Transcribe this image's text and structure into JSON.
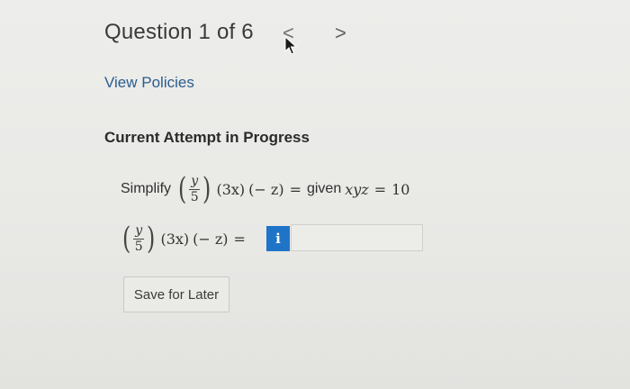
{
  "header": {
    "question_title": "Question 1 of 6",
    "prev_glyph": "<",
    "next_glyph": ">"
  },
  "links": {
    "view_policies": "View Policies"
  },
  "attempt": {
    "status": "Current Attempt in Progress"
  },
  "problem": {
    "prompt_word": "Simplify",
    "frac_num": "y",
    "frac_den": "5",
    "factor_3x": "(3x)",
    "factor_neg_z": "(− z)",
    "equals": "=",
    "given_word": "given",
    "condition_var": "xyz",
    "condition_value": "10"
  },
  "answer": {
    "info_label": "i",
    "value": ""
  },
  "buttons": {
    "save_for_later": "Save for Later"
  },
  "colors": {
    "link": "#2a5d8f",
    "info_button": "#1f74c7",
    "background": "#ebebe8"
  },
  "icons": {
    "cursor": "mouse-pointer-icon",
    "prev": "chevron-left-icon",
    "next": "chevron-right-icon"
  }
}
